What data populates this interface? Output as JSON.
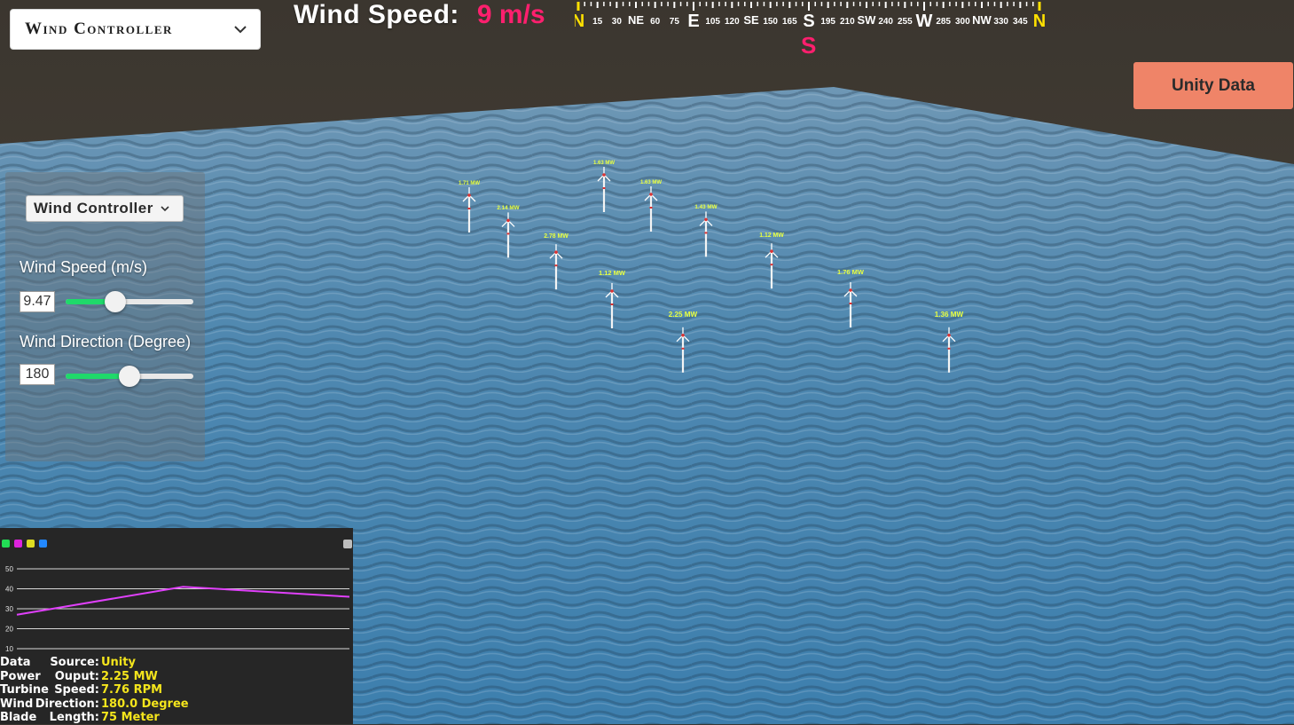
{
  "top_dropdown": {
    "label": "Wind Controller"
  },
  "header": {
    "title": "Wind Speed:",
    "value": "9 m/s"
  },
  "compass": {
    "labels": [
      "N",
      "15",
      "30",
      "NE",
      "60",
      "75",
      "E",
      "105",
      "120",
      "SE",
      "150",
      "165",
      "S",
      "195",
      "210",
      "SW",
      "240",
      "255",
      "W",
      "285",
      "300",
      "NW",
      "330",
      "345",
      "N"
    ],
    "current": "S"
  },
  "unity_button": {
    "label": "Unity Data"
  },
  "panel": {
    "dropdown": "Wind Controller",
    "wind_speed_label": "Wind Speed (m/s)",
    "wind_speed_value": "9.47",
    "wind_speed_fraction": 0.39,
    "wind_direction_label": "Wind Direction (Degree)",
    "wind_direction_value": "180",
    "wind_direction_fraction": 0.5
  },
  "turbines": [
    "1.71 MW",
    "2.14 MW",
    "2.78 MW",
    "1.63 MW",
    "1.63 MW",
    "1.43 MW",
    "1.12 MW",
    "1.12 MW",
    "2.25 MW",
    "1.76 MW",
    "1.36 MW"
  ],
  "chart_legend_colors": [
    "#22dd55",
    "#dd22dd",
    "#dddd22",
    "#2288ff"
  ],
  "chart_data": {
    "type": "line",
    "ylim": [
      10,
      50
    ],
    "yticks": [
      "50",
      "40",
      "30",
      "20",
      "10"
    ],
    "x": [
      0,
      1,
      2
    ],
    "series": [
      {
        "values": [
          27,
          41,
          36
        ],
        "color": "#e040fb"
      }
    ]
  },
  "info": [
    {
      "key_a": "Data",
      "key_b": "Source:",
      "value": "Unity"
    },
    {
      "key_a": "Power",
      "key_b": "Ouput:",
      "value": "2.25 MW"
    },
    {
      "key_a": "Turbine",
      "key_b": "Speed:",
      "value": "7.76 RPM"
    },
    {
      "key_a": "Wind",
      "key_b": "Direction:",
      "value": "180.0 Degree"
    },
    {
      "key_a": "Blade",
      "key_b": "Length:",
      "value": "75 Meter"
    }
  ]
}
